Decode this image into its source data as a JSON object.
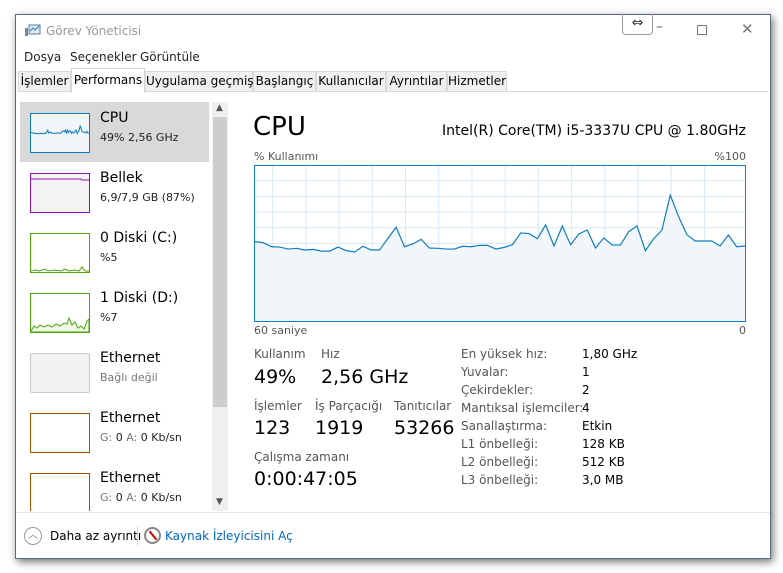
{
  "window": {
    "title": "Görev Yöneticisi"
  },
  "menu": [
    "Dosya",
    "Seçenekler",
    "Görüntüle"
  ],
  "tabs": [
    {
      "label": "İşlemler"
    },
    {
      "label": "Performans",
      "selected": true
    },
    {
      "label": "Uygulama geçmişi"
    },
    {
      "label": "Başlangıç"
    },
    {
      "label": "Kullanıcılar"
    },
    {
      "label": "Ayrıntılar"
    },
    {
      "label": "Hizmetler"
    }
  ],
  "sidebar": {
    "items": [
      {
        "name": "CPU",
        "sub": "49% 2,56 GHz",
        "color": "#117dbb"
      },
      {
        "name": "Bellek",
        "sub": "6,9/7,9 GB (87%)",
        "color": "#8b12ae"
      },
      {
        "name": "0 Diski (C:)",
        "sub": "%5",
        "color": "#4da60c"
      },
      {
        "name": "1 Diski (D:)",
        "sub": "%7",
        "color": "#4da60c"
      },
      {
        "name": "Ethernet",
        "sub": "Bağlı değil",
        "color": "#c0c0c0"
      },
      {
        "name": "Ethernet",
        "sub_g": "G:",
        "sub_gv": "0",
        "sub_a": "A:",
        "sub_av": "0 Kb/sn",
        "color": "#a74f01"
      },
      {
        "name": "Ethernet",
        "sub_g": "G:",
        "sub_gv": "0",
        "sub_a": "A:",
        "sub_av": "0 Kb/sn",
        "color": "#a74f01"
      }
    ]
  },
  "main": {
    "title": "CPU",
    "model": "Intel(R) Core(TM) i5-3337U CPU @ 1.80GHz",
    "graph": {
      "ylabel": "% Kullanımı",
      "ymax_label": "%100",
      "xleft": "60 saniye",
      "xright": "0",
      "line_color": "#117dbb",
      "fill_color": "#f1f6fa",
      "values": [
        51.2,
        50.5,
        47.9,
        47.7,
        46.4,
        46.9,
        45.8,
        46.2,
        45.1,
        45.1,
        47.7,
        45.4,
        44.5,
        48.2,
        45.8,
        45.8,
        53.3,
        60.5,
        47.9,
        49.7,
        52.7,
        47.1,
        46.9,
        46.4,
        46.4,
        48.2,
        47.9,
        48.8,
        48.8,
        46.4,
        47.5,
        49.2,
        56.8,
        56.4,
        53.1,
        62,
        48.4,
        61.3,
        49.2,
        56.2,
        58.7,
        47.1,
        53.6,
        49,
        49,
        57.7,
        61.3,
        45.4,
        53.1,
        58.7,
        81.2,
        67.4,
        55.7,
        51.6,
        51.6,
        51.6,
        48.4,
        55.5,
        47.9,
        48.4
      ]
    },
    "stats": {
      "usage_label": "Kullanım",
      "usage": "49%",
      "speed_label": "Hız",
      "speed": "2,56 GHz",
      "proc_label": "İşlemler",
      "proc": "123",
      "threads_label": "İş Parçacığı",
      "threads": "1919",
      "handles_label": "Tanıtıcılar",
      "handles": "53266",
      "uptime_label": "Çalışma zamanı",
      "uptime": "0:00:47:05"
    },
    "details": [
      {
        "label": "En yüksek hız:",
        "value": "1,80 GHz"
      },
      {
        "label": "Yuvalar:",
        "value": "1"
      },
      {
        "label": "Çekirdekler:",
        "value": "2"
      },
      {
        "label": "Mantıksal işlemciler:",
        "value": "4"
      },
      {
        "label": "Sanallaştırma:",
        "value": "Etkin"
      },
      {
        "label": "L1 önbelleği:",
        "value": "128 KB"
      },
      {
        "label": "L2 önbelleği:",
        "value": "512 KB"
      },
      {
        "label": "L3 önbelleği:",
        "value": "3,0 MB"
      }
    ]
  },
  "footer": {
    "less_details": "Daha az ayrıntı",
    "resource_monitor": "Kaynak İzleyicisini Aç",
    "link_color": "#0066cc"
  }
}
